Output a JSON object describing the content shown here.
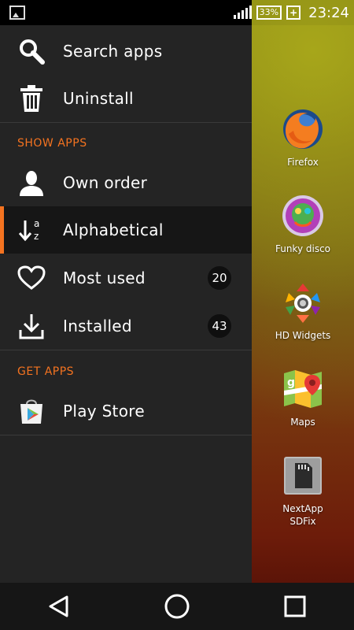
{
  "status_bar": {
    "battery": "33%",
    "time": "23:24"
  },
  "drawer": {
    "top_items": [
      {
        "label": "Search apps",
        "icon": "search-icon"
      },
      {
        "label": "Uninstall",
        "icon": "trash-icon"
      }
    ],
    "show_apps": {
      "title": "SHOW APPS",
      "items": [
        {
          "label": "Own order",
          "icon": "person-icon"
        },
        {
          "label": "Alphabetical",
          "icon": "sort-az-icon"
        },
        {
          "label": "Most used",
          "icon": "heart-icon",
          "count": "20"
        },
        {
          "label": "Installed",
          "icon": "download-icon",
          "count": "43"
        }
      ]
    },
    "get_apps": {
      "title": "GET APPS",
      "items": [
        {
          "label": "Play Store",
          "icon": "play-store-icon"
        }
      ]
    }
  },
  "home": {
    "apps": [
      {
        "label": "Firefox",
        "icon": "firefox-icon"
      },
      {
        "label": "Funky disco",
        "icon": "funky-disco-icon"
      },
      {
        "label": "HD Widgets",
        "icon": "hd-widgets-icon"
      },
      {
        "label": "Maps",
        "icon": "maps-icon"
      },
      {
        "label": "NextApp SDFix",
        "icon": "sdfix-icon"
      }
    ]
  },
  "navbar": {
    "buttons": [
      "back-icon",
      "home-icon",
      "recents-icon"
    ]
  },
  "colors": {
    "accent": "#f47320",
    "drawer_bg": "#242424"
  }
}
